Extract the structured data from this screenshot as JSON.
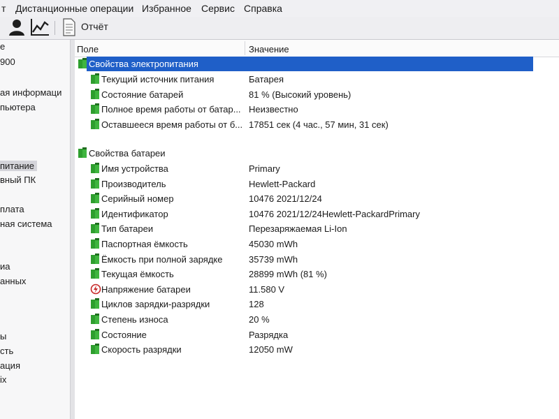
{
  "menu": {
    "items": [
      "т",
      "Дистанционные операции",
      "Избранное",
      "Сервис",
      "Справка"
    ]
  },
  "toolbar": {
    "report_label": "Отчёт"
  },
  "sidebar": {
    "items": [
      "е",
      "900",
      "ая информаци",
      "пьютера",
      "питание",
      "вный ПК",
      "плата",
      "ная система",
      "иа",
      "анных",
      "ы",
      "сть",
      "ация",
      "іх"
    ]
  },
  "columns": {
    "field": "Поле",
    "value": "Значение"
  },
  "groups": [
    {
      "title": "Свойства электропитания",
      "rows": [
        {
          "field": "Текущий источник питания",
          "value": "Батарея",
          "icon": "battery-icon"
        },
        {
          "field": "Состояние батарей",
          "value": "81 % (Высокий уровень)",
          "icon": "battery-icon"
        },
        {
          "field": "Полное время работы от батар...",
          "value": "Неизвестно",
          "icon": "battery-icon"
        },
        {
          "field": "Оставшееся время работы от б...",
          "value": "17851 сек (4 час., 57 мин, 31 сек)",
          "icon": "battery-icon"
        }
      ]
    },
    {
      "title": "Свойства батареи",
      "rows": [
        {
          "field": "Имя устройства",
          "value": "Primary",
          "icon": "battery-icon"
        },
        {
          "field": "Производитель",
          "value": "Hewlett-Packard",
          "icon": "battery-icon"
        },
        {
          "field": "Серийный номер",
          "value": "10476 2021/12/24",
          "icon": "battery-icon"
        },
        {
          "field": "Идентификатор",
          "value": "10476 2021/12/24Hewlett-PackardPrimary",
          "icon": "battery-icon"
        },
        {
          "field": "Тип батареи",
          "value": "Перезаряжаемая Li-Ion",
          "icon": "battery-icon"
        },
        {
          "field": "Паспортная ёмкость",
          "value": "45030 mWh",
          "icon": "battery-icon"
        },
        {
          "field": "Ёмкость при полной зарядке",
          "value": "35739 mWh",
          "icon": "battery-icon"
        },
        {
          "field": "Текущая ёмкость",
          "value": "28899 mWh  (81 %)",
          "icon": "battery-icon"
        },
        {
          "field": "Напряжение батареи",
          "value": "11.580 V",
          "icon": "voltage-icon"
        },
        {
          "field": "Циклов зарядки-разрядки",
          "value": "128",
          "icon": "battery-icon"
        },
        {
          "field": "Степень износа",
          "value": "20 %",
          "icon": "battery-icon"
        },
        {
          "field": "Состояние",
          "value": "Разрядка",
          "icon": "battery-icon"
        },
        {
          "field": "Скорость разрядки",
          "value": "12050 mW",
          "icon": "battery-icon"
        }
      ]
    }
  ],
  "colors": {
    "selection": "#1f5fc8",
    "battery_green": "#2e9e2e"
  }
}
